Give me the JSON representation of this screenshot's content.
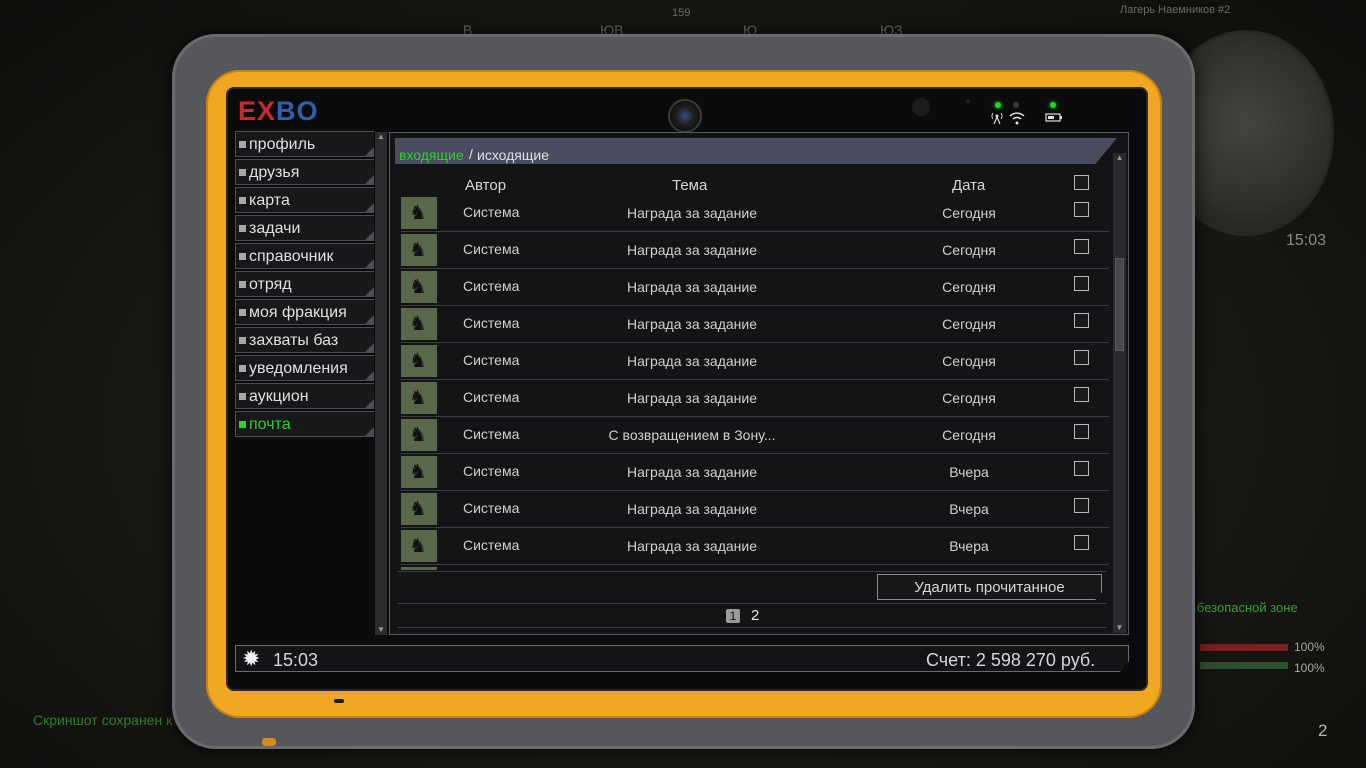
{
  "hud": {
    "compass": [
      "В",
      "ЮВ",
      "Ю",
      "ЮЗ"
    ],
    "heading": "159",
    "location": "Лагерь Наемников #2",
    "clock": "15:03",
    "safe_zone": "ь в безопасной зоне",
    "health": "100%",
    "stamina": "100%",
    "ammo": "2",
    "screenshot_notice": "Скриншот сохранен к"
  },
  "tablet": {
    "logo_left": "EX",
    "logo_right": "BO",
    "menu": [
      {
        "label": "профиль"
      },
      {
        "label": "друзья"
      },
      {
        "label": "карта"
      },
      {
        "label": "задачи"
      },
      {
        "label": "справочник"
      },
      {
        "label": "отряд"
      },
      {
        "label": "моя фракция"
      },
      {
        "label": "захваты баз"
      },
      {
        "label": "уведомления"
      },
      {
        "label": "аукцион"
      },
      {
        "label": "почта"
      }
    ],
    "active_menu": "почта",
    "mail": {
      "tab_inbox": "входящие",
      "tab_separator": "/",
      "tab_outbox": "исходящие",
      "columns": {
        "author": "Автор",
        "subject": "Тема",
        "date": "Дата"
      },
      "rows": [
        {
          "author": "Система",
          "subject": "Награда за задание",
          "date": "Сегодня"
        },
        {
          "author": "Система",
          "subject": "Награда за задание",
          "date": "Сегодня"
        },
        {
          "author": "Система",
          "subject": "Награда за задание",
          "date": "Сегодня"
        },
        {
          "author": "Система",
          "subject": "Награда за задание",
          "date": "Сегодня"
        },
        {
          "author": "Система",
          "subject": "Награда за задание",
          "date": "Сегодня"
        },
        {
          "author": "Система",
          "subject": "Награда за задание",
          "date": "Сегодня"
        },
        {
          "author": "Система",
          "subject": "С возвращением в Зону...",
          "date": "Сегодня"
        },
        {
          "author": "Система",
          "subject": "Награда за задание",
          "date": "Вчера"
        },
        {
          "author": "Система",
          "subject": "Награда за задание",
          "date": "Вчера"
        },
        {
          "author": "Система",
          "subject": "Награда за задание",
          "date": "Вчера"
        }
      ],
      "delete_read": "Удалить прочитанное",
      "pages": [
        "1",
        "2"
      ],
      "current_page": "1"
    },
    "status": {
      "time": "15:03",
      "balance": "Счет: 2 598 270 руб."
    }
  },
  "colors": {
    "accent_green": "#2fd12f",
    "tablet_orange": "#f0a722",
    "header_purple": "#4a4c60"
  }
}
